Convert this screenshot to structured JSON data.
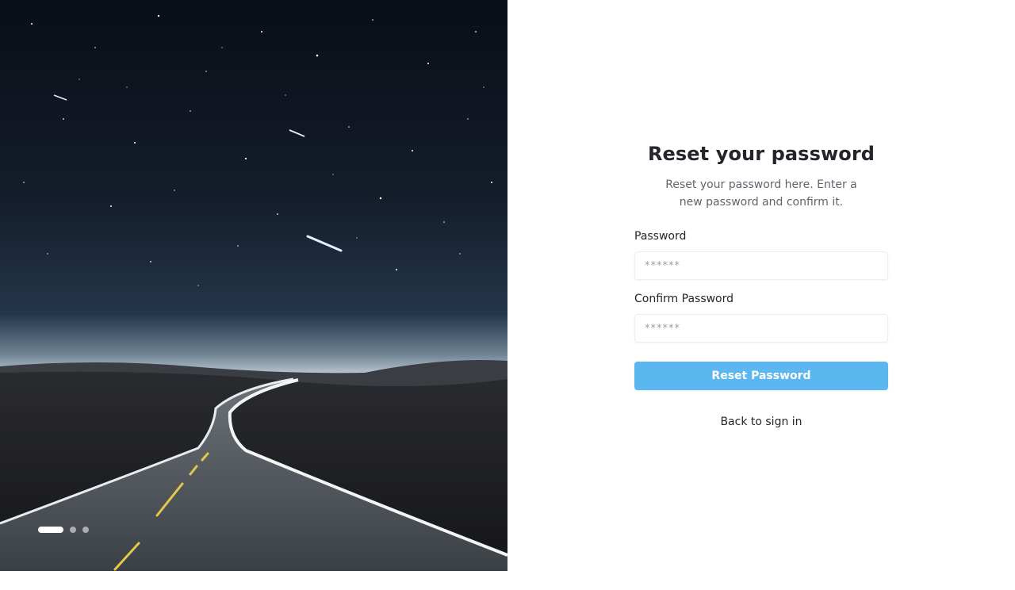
{
  "hero": {
    "image": "night-road-under-starry-sky",
    "carousel": {
      "total_slides": 3,
      "active_index": 0
    }
  },
  "form": {
    "title": "Reset your password",
    "subtitle": "Reset your password here. Enter a new password and confirm it.",
    "password": {
      "label": "Password",
      "placeholder": "******",
      "value": ""
    },
    "confirm_password": {
      "label": "Confirm Password",
      "placeholder": "******",
      "value": ""
    },
    "submit_label": "Reset Password",
    "back_link_label": "Back to sign in"
  },
  "colors": {
    "primary": "#5cb6ef",
    "text": "#22262b",
    "muted_text": "#5f656d",
    "input_border": "#eceef0"
  }
}
